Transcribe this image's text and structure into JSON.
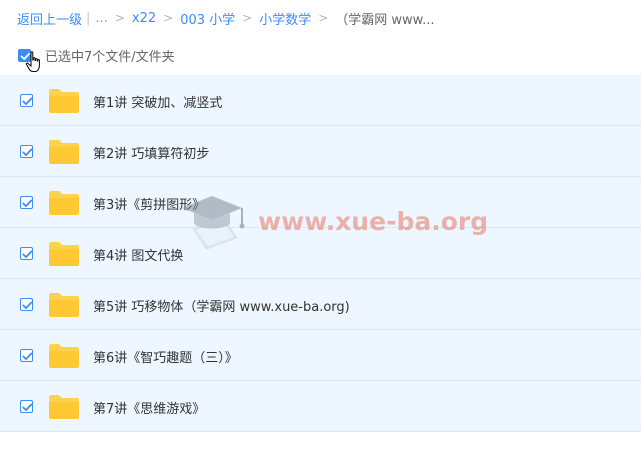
{
  "breadcrumb": {
    "back": "返回上一级",
    "ellipsis": "...",
    "items": [
      "x22",
      "003 小学",
      "小学数学"
    ],
    "current": "（学霸网 www..."
  },
  "selection": {
    "label": "已选中7个文件/文件夹"
  },
  "files": [
    {
      "name": "第1讲 突破加、减竖式"
    },
    {
      "name": "第2讲 巧填算符初步"
    },
    {
      "name": "第3讲《剪拼图形》"
    },
    {
      "name": "第4讲 图文代换"
    },
    {
      "name": "第5讲 巧移物体（学霸网 www.xue-ba.org)"
    },
    {
      "name": "第6讲《智巧趣题（三）》"
    },
    {
      "name": "第7讲《思维游戏》"
    }
  ],
  "watermark": {
    "text": "www.xue-ba.org"
  },
  "colors": {
    "accent": "#3b8cff",
    "row_bg": "#eef6ff",
    "folder": "#ffd24d"
  },
  "icons": {
    "checkbox": "check-icon",
    "folder": "folder-icon",
    "cursor": "hand-pointer-icon"
  }
}
